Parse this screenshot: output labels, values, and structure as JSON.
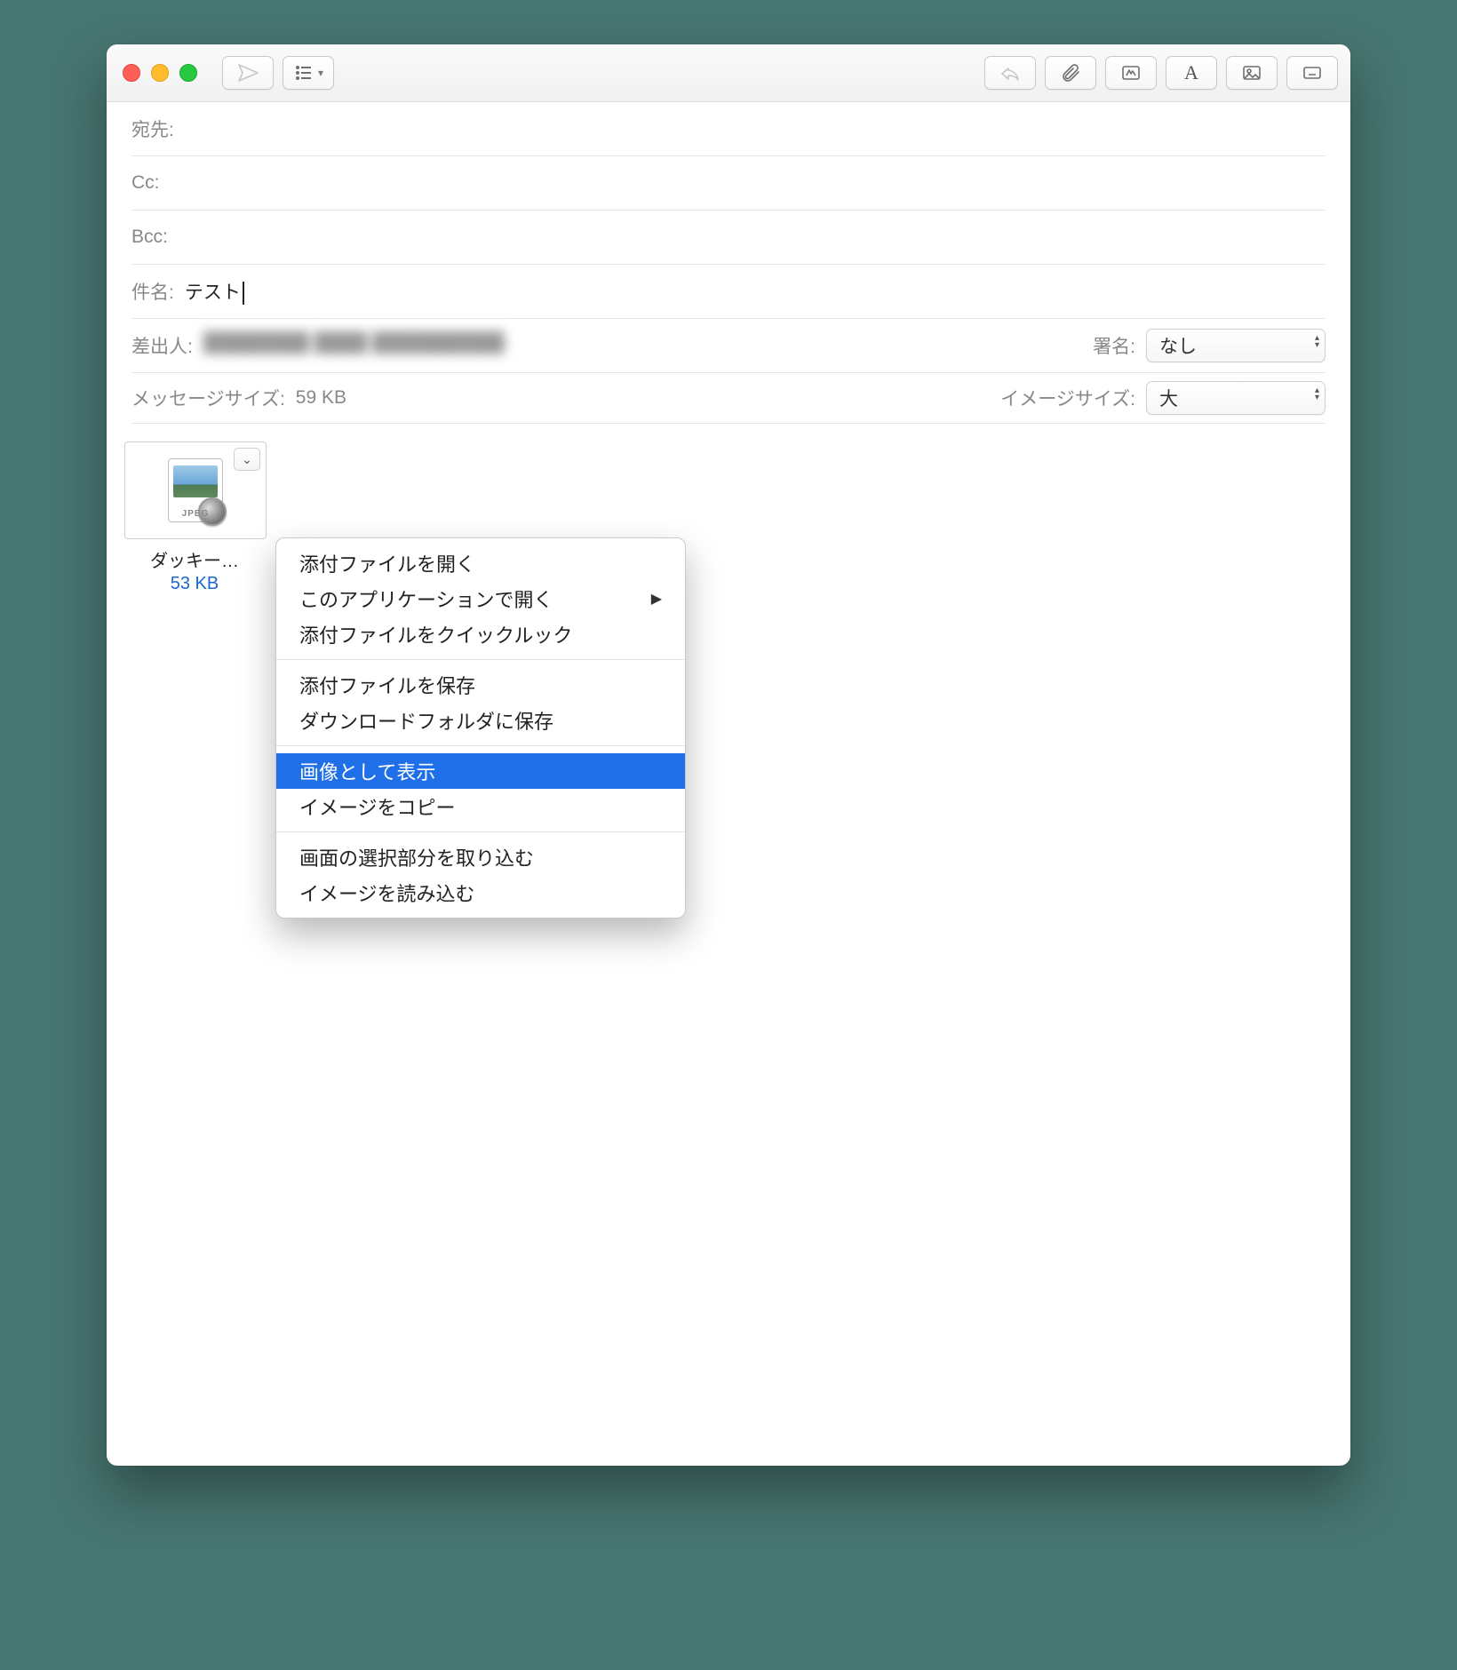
{
  "header": {
    "to_label": "宛先:",
    "cc_label": "Cc:",
    "bcc_label": "Bcc:",
    "subject_label": "件名:",
    "subject_value": "テスト",
    "from_label": "差出人:",
    "from_value": "████████ ████ ██████████",
    "signature_label": "署名:",
    "signature_value": "なし",
    "message_size_label": "メッセージサイズ:",
    "message_size_value": "59 KB",
    "image_size_label": "イメージサイズ:",
    "image_size_value": "大"
  },
  "attachment": {
    "type_badge": "JPEG",
    "filename": "ダッキー…",
    "filesize": "53 KB"
  },
  "context_menu": {
    "items": [
      {
        "label": "添付ファイルを開く",
        "submenu": false
      },
      {
        "label": "このアプリケーションで開く",
        "submenu": true
      },
      {
        "label": "添付ファイルをクイックルック",
        "submenu": false
      }
    ],
    "group2": [
      {
        "label": "添付ファイルを保存",
        "submenu": false
      },
      {
        "label": "ダウンロードフォルダに保存",
        "submenu": false
      }
    ],
    "group3": [
      {
        "label": "画像として表示",
        "submenu": false,
        "selected": true
      },
      {
        "label": "イメージをコピー",
        "submenu": false
      }
    ],
    "group4": [
      {
        "label": "画面の選択部分を取り込む",
        "submenu": false
      },
      {
        "label": "イメージを読み込む",
        "submenu": false
      }
    ]
  }
}
